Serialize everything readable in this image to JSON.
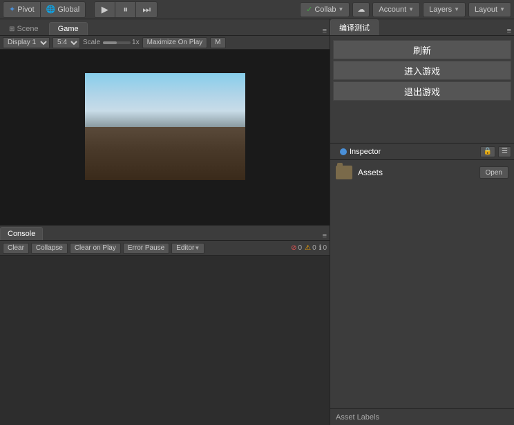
{
  "toolbar": {
    "pivot_label": "Pivot",
    "global_label": "Global",
    "play_icon": "▶",
    "pause_icon": "⏸",
    "step_icon": "⏭",
    "collab_label": "Collab",
    "collab_arrow": "▼",
    "cloud_icon": "☁",
    "account_label": "Account",
    "account_arrow": "▼",
    "layers_label": "Layers",
    "layers_arrow": "▼",
    "layout_label": "Layout",
    "layout_arrow": "▼"
  },
  "scene_game_tabs": {
    "scene_label": "Scene",
    "game_label": "Game"
  },
  "game_toolbar": {
    "display_label": "Display 1",
    "aspect_label": "5:4",
    "scale_label": "Scale",
    "scale_value": "1x",
    "maximize_label": "Maximize On Play",
    "mute_label": "M"
  },
  "console": {
    "tab_label": "Console",
    "clear_label": "Clear",
    "collapse_label": "Collapse",
    "clear_on_play_label": "Clear on Play",
    "error_pause_label": "Error Pause",
    "editor_label": "Editor",
    "editor_arrow": "▼",
    "error_count": "0",
    "warning_count": "0",
    "info_count": "0",
    "error_icon": "⊘",
    "warning_icon": "⚠",
    "info_icon": "ℹ"
  },
  "compile_panel": {
    "tab_label": "编译测试",
    "menu_items": [
      {
        "label": "刷新"
      },
      {
        "label": "进入游戏"
      },
      {
        "label": "退出游戏"
      }
    ]
  },
  "inspector": {
    "tab_label": "Inspector",
    "icon_color": "#4a90d9",
    "lock_icon": "🔒",
    "menu_icon": "☰",
    "assets_label": "Assets",
    "open_label": "Open"
  },
  "asset_labels": {
    "label": "Asset Labels"
  }
}
